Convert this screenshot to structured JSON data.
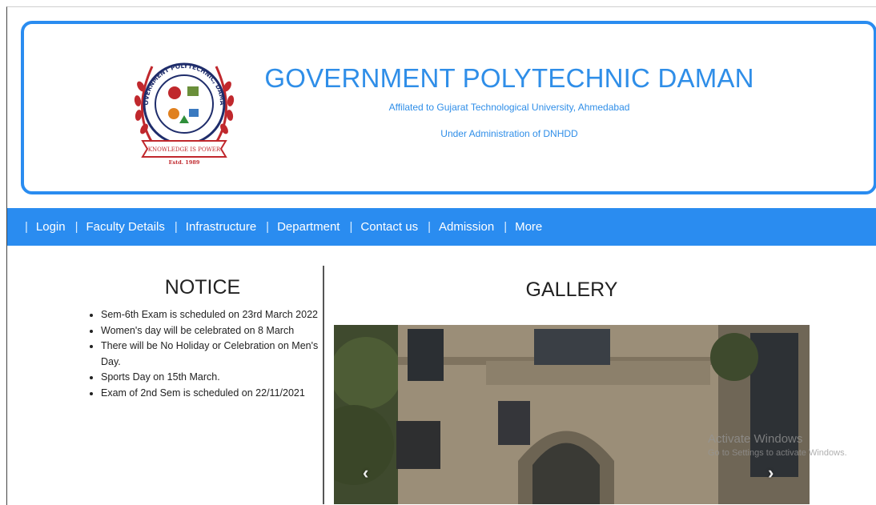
{
  "header": {
    "college_name": "GOVERNMENT POLYTECHNIC DAMAN",
    "affiliation": "Affilated to Gujarat Technological University, Ahmedabad",
    "administration": "Under Administration of DNHDD",
    "logo": {
      "ring_text_top": "GOVERNMENT POLYTECHNIC, DAMAN",
      "motto": "KNOWLEDGE IS POWER",
      "established": "Estd. 1989"
    }
  },
  "nav": {
    "separator": "|",
    "items": [
      {
        "label": "Login"
      },
      {
        "label": "Faculty Details"
      },
      {
        "label": "Infrastructure"
      },
      {
        "label": "Department"
      },
      {
        "label": "Contact us"
      },
      {
        "label": "Admission"
      },
      {
        "label": "More"
      }
    ]
  },
  "notice": {
    "title": "NOTICE",
    "items": [
      "Sem-6th Exam is scheduled on 23rd March 2022",
      "Women's day will be celebrated on 8 March",
      "There will be No Holiday or Celebration on Men's Day.",
      "Sports Day on 15th March.",
      "Exam of 2nd Sem is scheduled on 22/11/2021"
    ]
  },
  "gallery": {
    "title": "GALLERY",
    "prev_icon": "chevron-left-icon",
    "next_icon": "chevron-right-icon",
    "prev_glyph": "‹",
    "next_glyph": "›"
  },
  "overlay": {
    "activate_title": "Activate Windows",
    "activate_subtitle": "Go to Settings to activate Windows."
  },
  "colors": {
    "accent": "#2a8cf0",
    "title_blue": "#2f8ee8",
    "logo_red": "#c0282d",
    "logo_navy": "#1f2d6b"
  }
}
